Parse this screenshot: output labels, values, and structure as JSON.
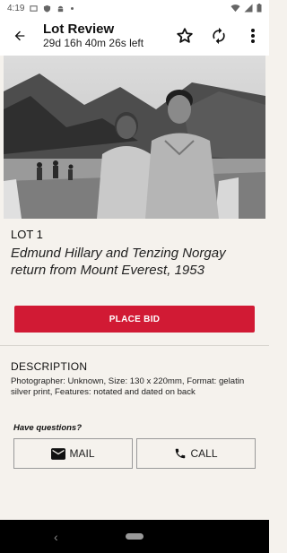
{
  "status_bar": {
    "time": "4:19"
  },
  "app_bar": {
    "title": "Lot Review",
    "countdown": "29d 16h 40m 26s left"
  },
  "lot": {
    "number_label": "LOT 1",
    "title": "Edmund Hillary and Tenzing Norgay return from Mount Everest, 1953"
  },
  "bid": {
    "label": "PLACE BID",
    "color": "#d11a34"
  },
  "description": {
    "heading": "DESCRIPTION",
    "text": "Photographer: Unknown, Size: 130 x 220mm, Format: gelatin silver print, Features: notated and dated on back"
  },
  "contact": {
    "question": "Have questions?",
    "mail_label": "MAIL",
    "call_label": "CALL"
  },
  "icons": {
    "back": "arrow-left-icon",
    "favorite": "star-outline-icon",
    "refresh": "refresh-icon",
    "more": "more-vert-icon",
    "mail": "mail-icon",
    "call": "phone-icon"
  }
}
